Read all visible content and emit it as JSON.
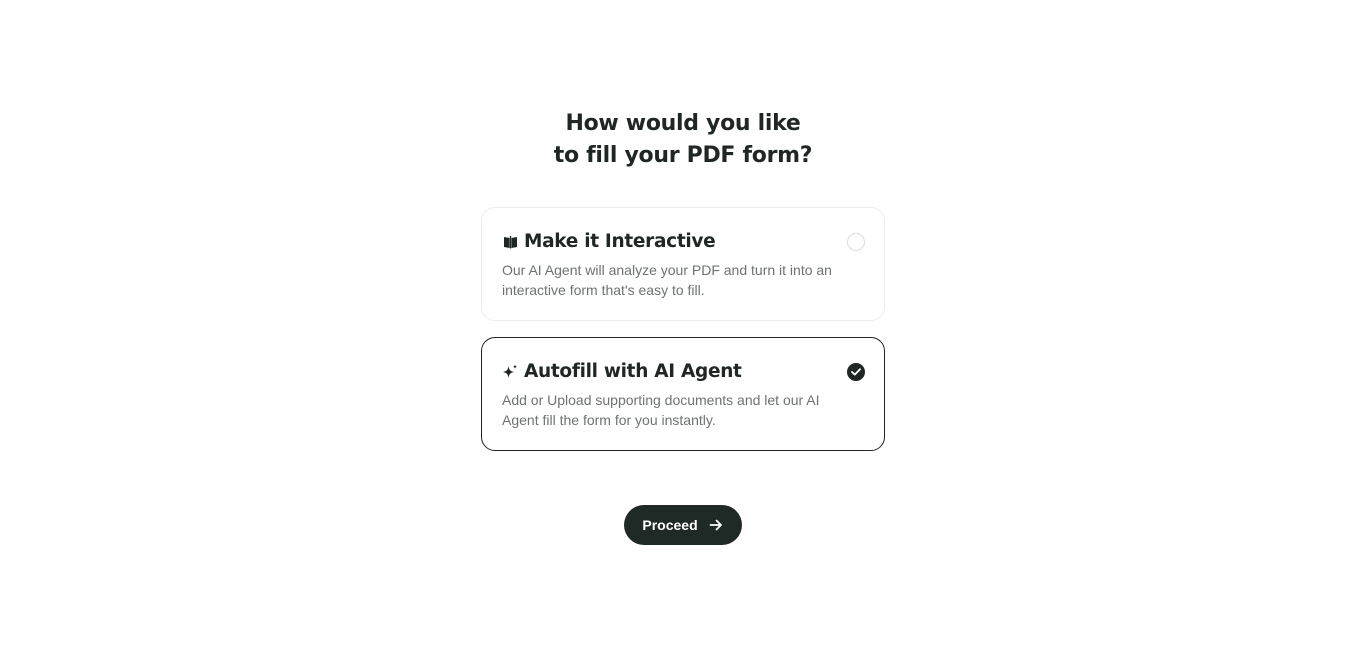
{
  "heading": {
    "line1": "How would you like",
    "line2": "to fill your PDF form?"
  },
  "options": [
    {
      "icon": "book-icon",
      "title": "Make it Interactive",
      "description": "Our AI Agent will analyze your PDF and turn it into an interactive form that's easy to fill.",
      "selected": false
    },
    {
      "icon": "sparkle-icon",
      "title": "Autofill with AI Agent",
      "description": "Add or Upload supporting documents and let our AI Agent fill the form for you instantly.",
      "selected": true
    }
  ],
  "proceed": {
    "label": "Proceed",
    "icon": "arrow-right-icon"
  },
  "colors": {
    "primary": "#1f2a26",
    "text": "#1f2623",
    "muted": "#6e7370",
    "border": "#ecedee"
  }
}
